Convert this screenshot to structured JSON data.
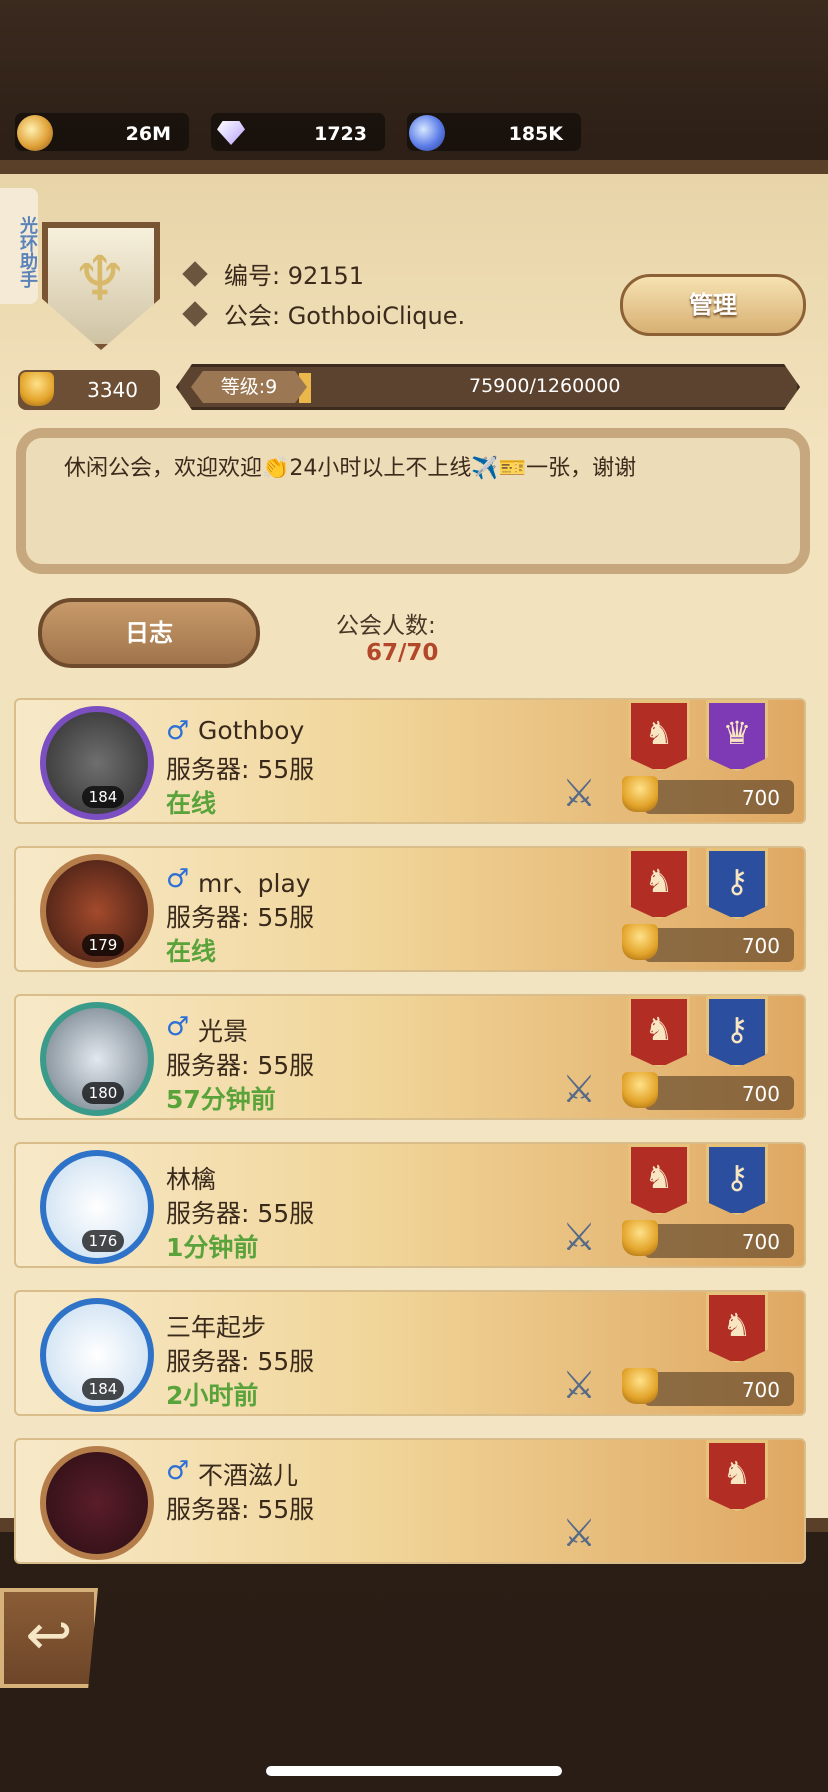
{
  "currency": [
    {
      "icon": "gold-coin-icon",
      "amount": "26M"
    },
    {
      "icon": "diamond-icon",
      "amount": "1723"
    },
    {
      "icon": "blue-orb-icon",
      "amount": "185K"
    }
  ],
  "side_tab": {
    "label": "光环助手"
  },
  "guild": {
    "id_label": "编号: 92151",
    "name_label": "公会: GothboiClique.",
    "manage_label": "管理",
    "trophies": "3340",
    "level_label": "等级:9",
    "progress_text": "75900/1260000",
    "progress_fraction": 0.06,
    "announcement": "休闲公会，欢迎欢迎👏24小时以上不上线✈️🎫一张，谢谢"
  },
  "log_button": {
    "label": "日志"
  },
  "member_count": {
    "label": "公会人数:",
    "value": "67/70"
  },
  "members": [
    {
      "name": "Gothboy",
      "gender": "♂",
      "server": "服务器: 55服",
      "status": "在线",
      "level": "184",
      "score": "700",
      "banners": [
        "red",
        "purple"
      ],
      "sword": true
    },
    {
      "name": "mr、play",
      "gender": "♂",
      "server": "服务器: 55服",
      "status": "在线",
      "level": "179",
      "score": "700",
      "banners": [
        "red",
        "blue"
      ],
      "sword": false
    },
    {
      "name": "光景",
      "gender": "♂",
      "server": "服务器: 55服",
      "status": "57分钟前",
      "level": "180",
      "score": "700",
      "banners": [
        "red",
        "blue"
      ],
      "sword": true
    },
    {
      "name": "林檎",
      "gender": "",
      "server": "服务器: 55服",
      "status": "1分钟前",
      "level": "176",
      "score": "700",
      "banners": [
        "red",
        "blue"
      ],
      "sword": true
    },
    {
      "name": "三年起步",
      "gender": "",
      "server": "服务器: 55服",
      "status": "2小时前",
      "level": "184",
      "score": "700",
      "banners": [
        "red"
      ],
      "sword": true
    },
    {
      "name": "不酒滋儿",
      "gender": "♂",
      "server": "服务器: 55服",
      "status": "",
      "level": "",
      "score": "",
      "banners": [
        "red"
      ],
      "sword": true
    }
  ]
}
